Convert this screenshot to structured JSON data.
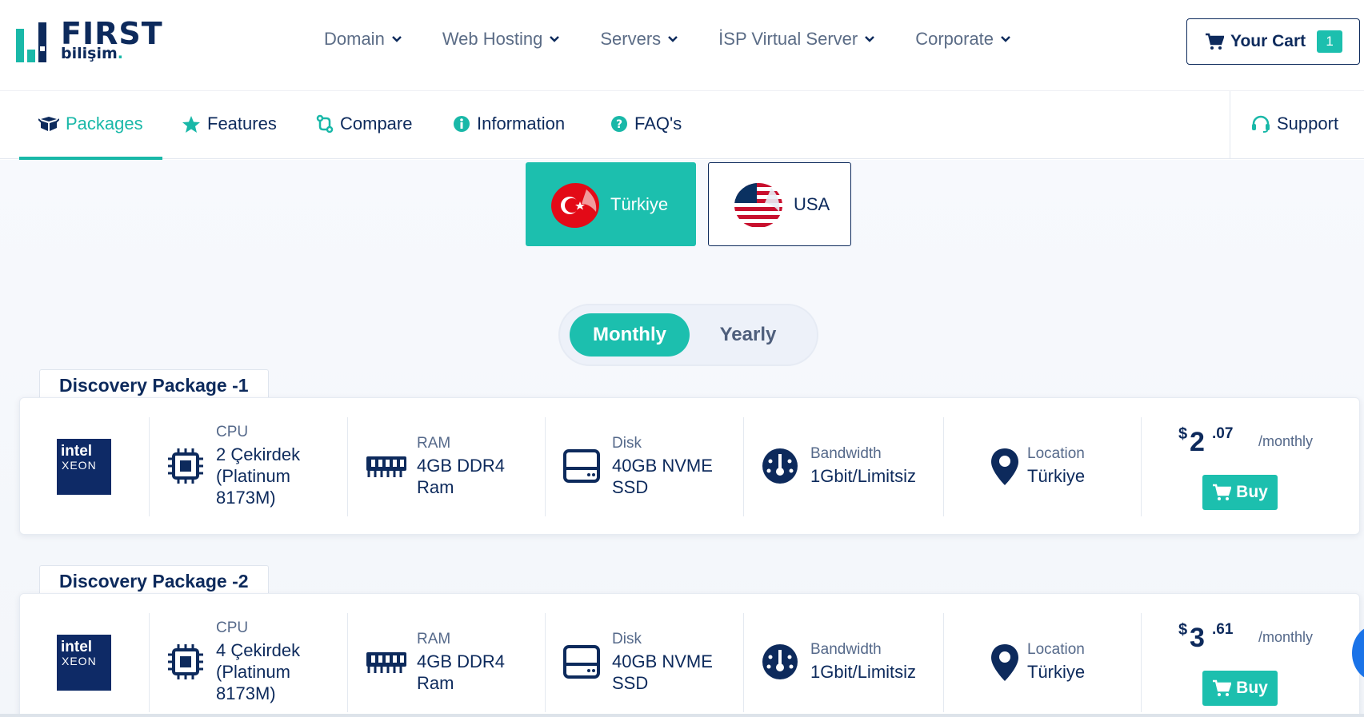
{
  "header": {
    "logo_word": "FIRST",
    "logo_sub": "bilişim",
    "nav": [
      {
        "label": "Domain"
      },
      {
        "label": "Web Hosting"
      },
      {
        "label": "Servers"
      },
      {
        "label": "İSP Virtual Server"
      },
      {
        "label": "Corporate"
      }
    ],
    "cart_label": "Your Cart",
    "cart_count": "1"
  },
  "subnav": {
    "tabs": [
      {
        "label": "Packages",
        "active": true
      },
      {
        "label": "Features"
      },
      {
        "label": "Compare"
      },
      {
        "label": "Information"
      },
      {
        "label": "FAQ's"
      }
    ],
    "support_label": "Support"
  },
  "locations": [
    {
      "label": "Türkiye",
      "selected": true
    },
    {
      "label": "USA",
      "selected": false
    }
  ],
  "billing_toggle": {
    "monthly": "Monthly",
    "yearly": "Yearly",
    "selected": "monthly"
  },
  "packages": [
    {
      "name": "Discovery Package -1",
      "processor_logo": {
        "line1": "intel",
        "line2": "XEON"
      },
      "cpu": {
        "label": "CPU",
        "value": [
          "2 Çekirdek",
          "(Platinum",
          "8173M)"
        ]
      },
      "ram": {
        "label": "RAM",
        "value": [
          "4GB DDR4",
          "Ram"
        ]
      },
      "disk": {
        "label": "Disk",
        "value": [
          "40GB NVME",
          "SSD"
        ]
      },
      "bandwidth": {
        "label": "Bandwidth",
        "value": "1Gbit/Limitsiz"
      },
      "location": {
        "label": "Location",
        "value": "Türkiye"
      },
      "price": {
        "currency": "$",
        "integer": "2",
        "decimal": ".07",
        "period": "/monthly"
      },
      "buy_label": "Buy"
    },
    {
      "name": "Discovery Package -2",
      "processor_logo": {
        "line1": "intel",
        "line2": "XEON"
      },
      "cpu": {
        "label": "CPU",
        "value": [
          "4 Çekirdek",
          "(Platinum",
          "8173M)"
        ]
      },
      "ram": {
        "label": "RAM",
        "value": [
          "4GB DDR4",
          "Ram"
        ]
      },
      "disk": {
        "label": "Disk",
        "value": [
          "40GB NVME",
          "SSD"
        ]
      },
      "bandwidth": {
        "label": "Bandwidth",
        "value": "1Gbit/Limitsiz"
      },
      "location": {
        "label": "Location",
        "value": "Türkiye"
      },
      "price": {
        "currency": "$",
        "integer": "3",
        "decimal": ".61",
        "period": "/monthly"
      },
      "buy_label": "Buy"
    }
  ],
  "colors": {
    "brand_teal": "#1cbfae",
    "navy": "#0d2a5c",
    "muted": "#55698a"
  }
}
